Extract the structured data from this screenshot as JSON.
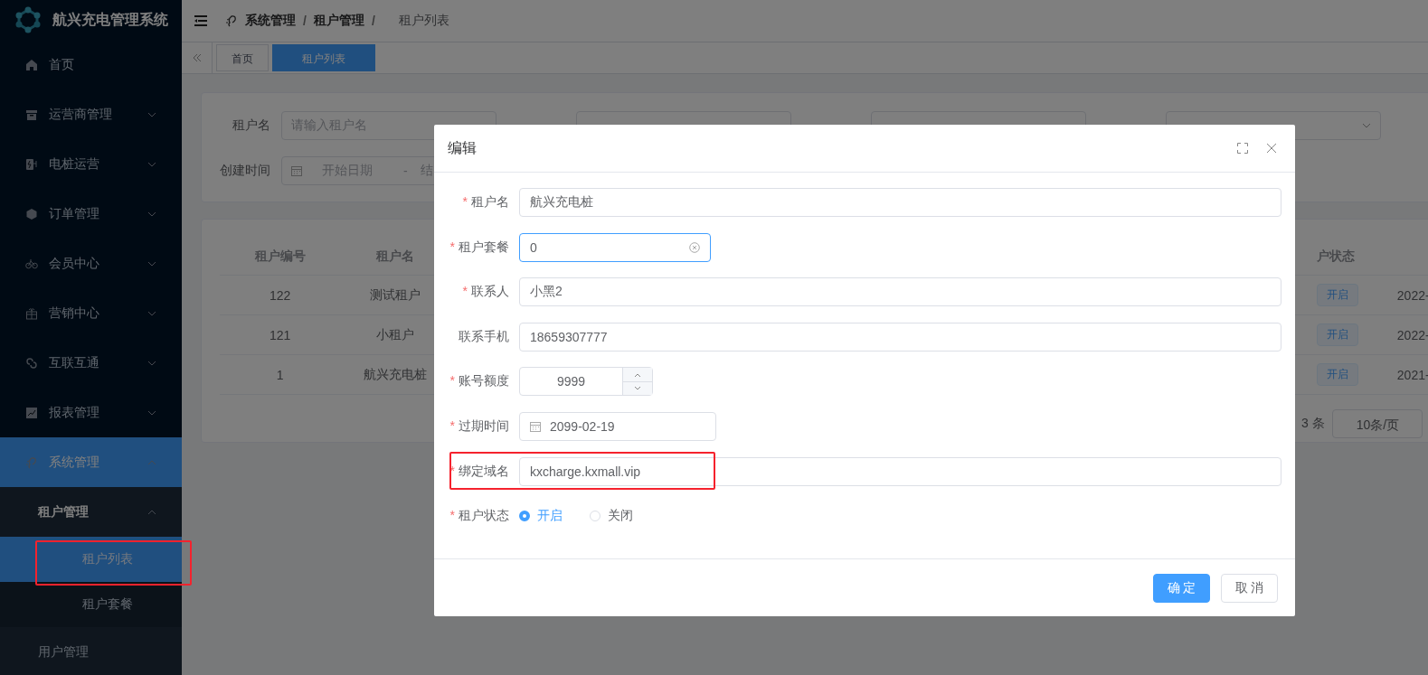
{
  "sidebar": {
    "title": "航兴充电管理系统",
    "items": [
      {
        "label": "首页",
        "kind": "link",
        "selected": false
      },
      {
        "label": "运营商管理",
        "kind": "submenu",
        "expanded": false,
        "selected": false
      },
      {
        "label": "电桩运营",
        "kind": "submenu",
        "expanded": false,
        "selected": false
      },
      {
        "label": "订单管理",
        "kind": "submenu",
        "expanded": false,
        "selected": false
      },
      {
        "label": "会员中心",
        "kind": "submenu",
        "expanded": false,
        "selected": false
      },
      {
        "label": "营销中心",
        "kind": "submenu",
        "expanded": false,
        "selected": false
      },
      {
        "label": "互联互通",
        "kind": "submenu",
        "expanded": false,
        "selected": false
      },
      {
        "label": "报表管理",
        "kind": "submenu",
        "expanded": false,
        "selected": false
      },
      {
        "label": "系统管理",
        "kind": "submenu",
        "expanded": true,
        "selected": true,
        "children": [
          {
            "label": "租户管理",
            "kind": "submenu",
            "expanded": true,
            "selected": false,
            "children": [
              {
                "label": "租户列表",
                "kind": "link",
                "selected": true,
                "highlighted": true
              },
              {
                "label": "租户套餐",
                "kind": "link",
                "selected": false,
                "highlighted": false
              }
            ]
          },
          {
            "label": "用户管理",
            "kind": "link",
            "selected": false
          }
        ]
      }
    ]
  },
  "header": {
    "breadcrumb": [
      {
        "label": "系统管理",
        "current": false,
        "separator": "/"
      },
      {
        "label": "租户管理",
        "current": false,
        "separator": "/"
      },
      {
        "label": "租户列表",
        "current": true
      }
    ]
  },
  "tabs": [
    {
      "label": "首页",
      "selected": false
    },
    {
      "label": "租户列表",
      "selected": true
    }
  ],
  "filters": {
    "fields": [
      {
        "kind": "text",
        "label": "租户名",
        "placeholder": "请输入租户名"
      },
      {
        "kind": "text"
      },
      {
        "kind": "text"
      },
      {
        "kind": "select"
      },
      {
        "kind": "daterange",
        "label": "创建时间",
        "start_placeholder": "开始日期",
        "range_separator": "-",
        "end_placeholder": "结"
      }
    ]
  },
  "table": {
    "columns": [
      "租户编号",
      "租户名",
      "户状态"
    ],
    "rows": [
      {
        "id": "122",
        "name": "测试租户",
        "status": "开启",
        "column_4": "2022-"
      },
      {
        "id": "121",
        "name": "小租户",
        "status": "开启",
        "column_4": "2022-"
      },
      {
        "id": "1",
        "name": "航兴充电桩",
        "status": "开启",
        "column_4": "2021-"
      }
    ],
    "pagination": {
      "total": "3 条",
      "page_size": "10条/页"
    }
  },
  "modal": {
    "title": "编辑",
    "fields": [
      {
        "kind": "text",
        "label": "租户名",
        "required_mark": "*",
        "value": "航兴充电桩",
        "highlighted": false
      },
      {
        "kind": "select",
        "label": "租户套餐",
        "required_mark": "*",
        "value": "0",
        "focused": true,
        "highlighted": false
      },
      {
        "kind": "text",
        "label": "联系人",
        "required_mark": "*",
        "value": "小黑2",
        "highlighted": false
      },
      {
        "kind": "text",
        "label": "联系手机",
        "value": "18659307777",
        "highlighted": false
      },
      {
        "kind": "number",
        "label": "账号额度",
        "required_mark": "*",
        "value": "9999",
        "highlighted": false
      },
      {
        "kind": "date",
        "label": "过期时间",
        "required_mark": "*",
        "value": "2099-02-19",
        "highlighted": false
      },
      {
        "kind": "text",
        "label": "绑定域名",
        "required_mark": "*",
        "value": "kxcharge.kxmall.vip",
        "highlighted": true
      },
      {
        "kind": "radio",
        "label": "租户状态",
        "required_mark": "*",
        "highlighted": false,
        "options": [
          {
            "label": "开启",
            "selected": true
          },
          {
            "label": "关闭",
            "selected": false
          }
        ]
      }
    ],
    "buttons": [
      {
        "label": "确 定",
        "kind": "primary"
      },
      {
        "label": "取 消",
        "kind": "default"
      }
    ]
  }
}
